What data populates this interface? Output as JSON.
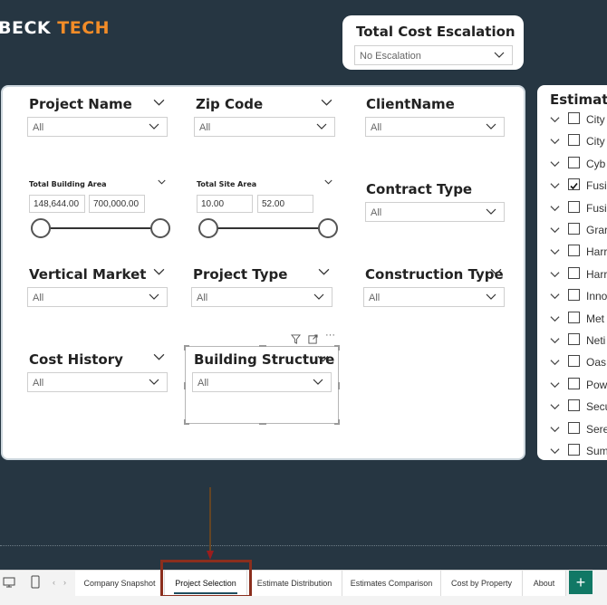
{
  "logo": {
    "text": "BECK",
    "accent": " TECH"
  },
  "total_cost": {
    "title": "Total Cost Escalation",
    "value": "No Escalation"
  },
  "slicers": {
    "project_name": {
      "title": "Project Name",
      "value": "All"
    },
    "zip_code": {
      "title": "Zip Code",
      "value": "All"
    },
    "client_name": {
      "title": "ClientName",
      "value": "All"
    },
    "contract_type": {
      "title": "Contract Type",
      "value": "All"
    },
    "vertical_market": {
      "title": "Vertical Market",
      "value": "All"
    },
    "project_type": {
      "title": "Project Type",
      "value": "All"
    },
    "construction_type": {
      "title": "Construction Type",
      "value": "All"
    },
    "cost_history": {
      "title": "Cost History",
      "value": "All"
    },
    "building_structure": {
      "title": "Building Structure",
      "value": "All"
    }
  },
  "total_building_area": {
    "title": "Total Building Area",
    "min": "148,644.00",
    "max": "700,000.00"
  },
  "total_site_area": {
    "title": "Total Site Area",
    "min": "10.00",
    "max": "52.00"
  },
  "estimate_panel": {
    "title": "Estimate",
    "items": [
      {
        "label": "City",
        "checked": false
      },
      {
        "label": "City",
        "checked": false
      },
      {
        "label": "Cyb",
        "checked": false
      },
      {
        "label": "Fusi",
        "checked": true
      },
      {
        "label": "Fusi",
        "checked": false
      },
      {
        "label": "Grar",
        "checked": false
      },
      {
        "label": "Harr",
        "checked": false
      },
      {
        "label": "Harr",
        "checked": false
      },
      {
        "label": "Inno",
        "checked": false
      },
      {
        "label": "Met",
        "checked": false
      },
      {
        "label": "Neti",
        "checked": false
      },
      {
        "label": "Oas",
        "checked": false
      },
      {
        "label": "Pow",
        "checked": false
      },
      {
        "label": "Secu",
        "checked": false
      },
      {
        "label": "Sere",
        "checked": false
      },
      {
        "label": "Sum",
        "checked": false
      }
    ]
  },
  "tabs": [
    {
      "label": "Company Snapshot"
    },
    {
      "label": "Project Selection"
    },
    {
      "label": "Estimate Distribution"
    },
    {
      "label": "Estimates Comparison"
    },
    {
      "label": "Cost by Property"
    },
    {
      "label": "About"
    }
  ],
  "add_button": "+",
  "colors": {
    "background": "#263642",
    "accent": "#f28c28",
    "highlight": "#8b2e1d",
    "add_button": "#117865"
  }
}
